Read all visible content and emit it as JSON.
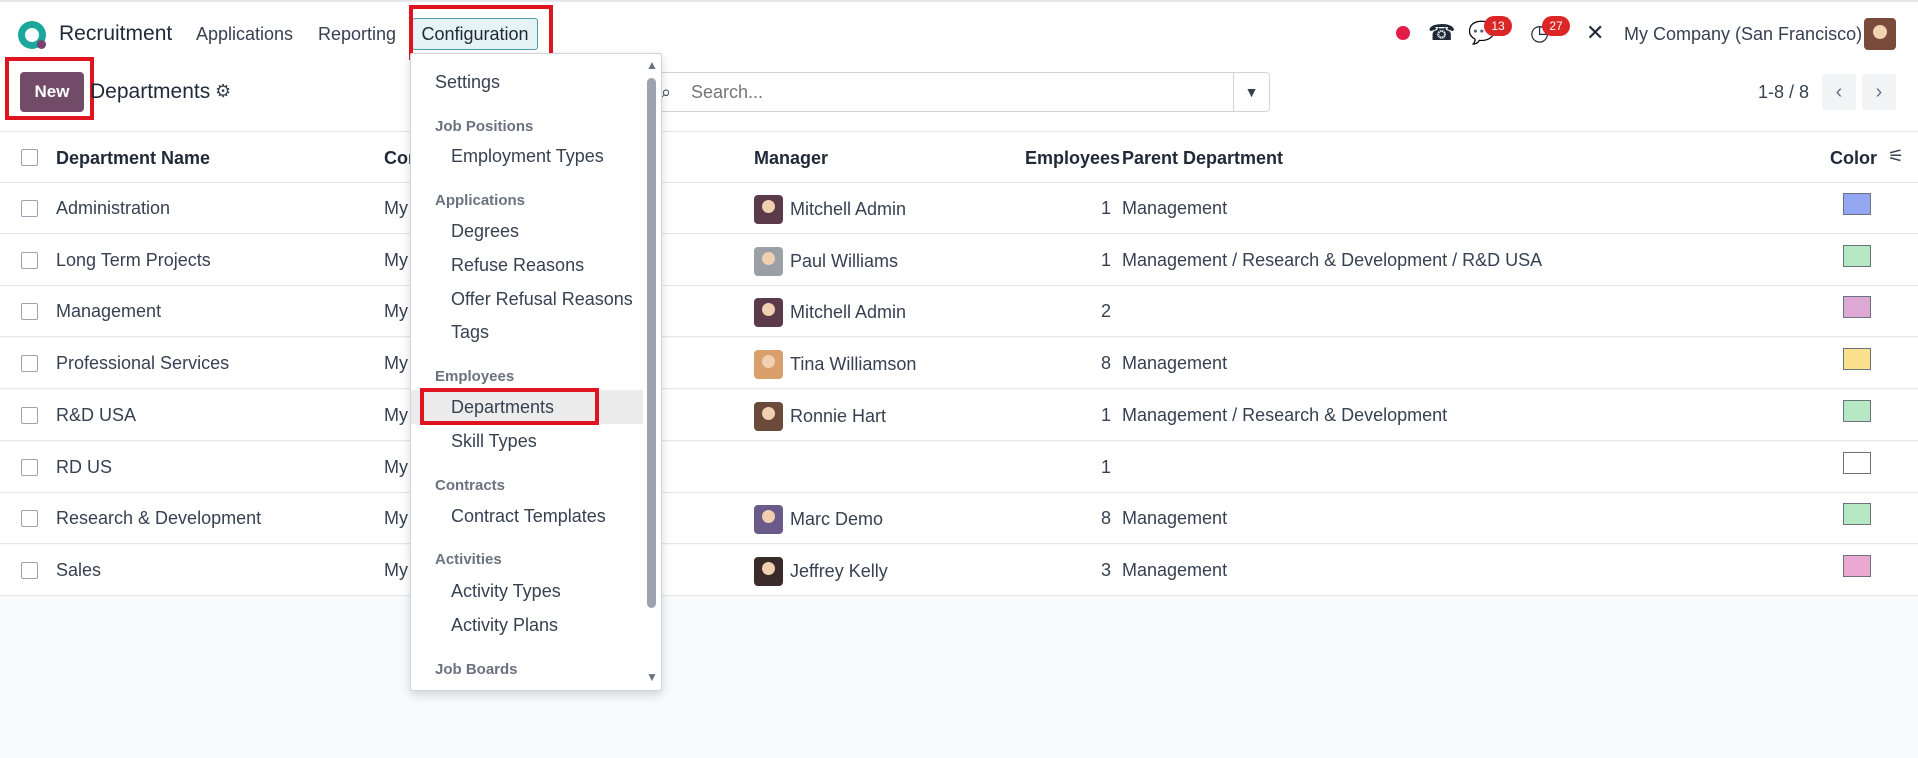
{
  "topbar": {
    "app_title": "Recruitment",
    "nav": [
      "Applications",
      "Reporting",
      "Configuration"
    ],
    "messages_count": "13",
    "activities_count": "27",
    "company": "My Company (San Francisco)"
  },
  "control": {
    "new_label": "New",
    "breadcrumb": "Departments",
    "search_placeholder": "Search...",
    "pager": "1-8 / 8"
  },
  "table": {
    "headers": {
      "name": "Department Name",
      "company": "Cor",
      "manager": "Manager",
      "employees": "Employees",
      "parent": "Parent Department",
      "color": "Color"
    },
    "rows": [
      {
        "name": "Administration",
        "company": "My",
        "manager": "Mitchell Admin",
        "employees": "1",
        "parent": "Management",
        "color": "#93a8f0"
      },
      {
        "name": "Long Term Projects",
        "company": "My",
        "manager": "Paul Williams",
        "employees": "1",
        "parent": "Management / Research & Development / R&D USA",
        "color": "#b5e8c3"
      },
      {
        "name": "Management",
        "company": "My",
        "manager": "Mitchell Admin",
        "employees": "2",
        "parent": "",
        "color": "#dda8d3"
      },
      {
        "name": "Professional Services",
        "company": "My",
        "manager": "Tina Williamson",
        "employees": "8",
        "parent": "Management",
        "color": "#fbe08e"
      },
      {
        "name": "R&D USA",
        "company": "My",
        "manager": "Ronnie Hart",
        "employees": "1",
        "parent": "Management / Research & Development",
        "color": "#b5e8c3"
      },
      {
        "name": "RD US",
        "company": "My",
        "manager": "",
        "employees": "1",
        "parent": "",
        "color": "#ffffff"
      },
      {
        "name": "Research & Development",
        "company": "My",
        "manager": "Marc Demo",
        "employees": "8",
        "parent": "Management",
        "color": "#b5e8c3"
      },
      {
        "name": "Sales",
        "company": "My",
        "manager": "Jeffrey Kelly",
        "employees": "3",
        "parent": "Management",
        "color": "#eaa8d3"
      }
    ]
  },
  "menu": {
    "settings": "Settings",
    "job_positions": "Job Positions",
    "employment_types": "Employment Types",
    "applications": "Applications",
    "degrees": "Degrees",
    "refuse_reasons": "Refuse Reasons",
    "offer_refusal_reasons": "Offer Refusal Reasons",
    "tags": "Tags",
    "employees": "Employees",
    "departments": "Departments",
    "skill_types": "Skill Types",
    "contracts": "Contracts",
    "contract_templates": "Contract Templates",
    "activities": "Activities",
    "activity_types": "Activity Types",
    "activity_plans": "Activity Plans",
    "job_boards": "Job Boards"
  }
}
